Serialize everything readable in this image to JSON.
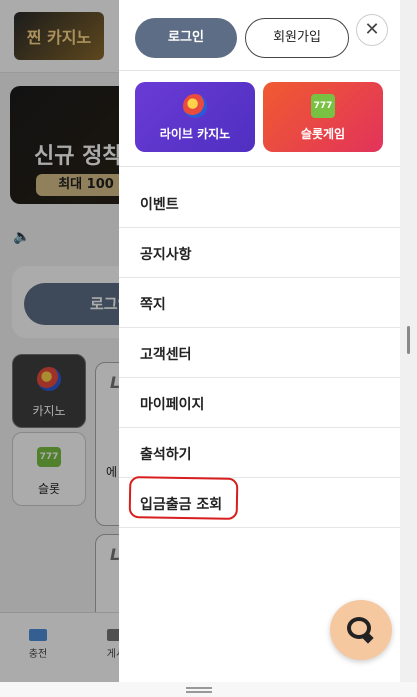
{
  "background": {
    "logo_text": "찐 카지노",
    "banner": {
      "headline": "신규 정착",
      "badge": "최대 100"
    },
    "login_label": "로그인",
    "tiles": [
      {
        "label": "카지노",
        "selected": true
      },
      {
        "label": "슬롯",
        "selected": false
      }
    ],
    "card_letter": "L",
    "card_partial_text": "에",
    "bottom_nav": [
      {
        "label": "충전"
      },
      {
        "label": "게시"
      }
    ]
  },
  "drawer": {
    "login_button": "로그인",
    "signup_button": "회원가입",
    "close_glyph": "✕",
    "game_cards": [
      {
        "label": "라이브 카지노",
        "icon": "casino-chip-icon",
        "color": "#5a37cf"
      },
      {
        "label": "슬롯게임",
        "icon": "slot-777-icon",
        "icon_text": "777",
        "color": "#e6414a"
      }
    ],
    "menu": [
      {
        "label": "이벤트"
      },
      {
        "label": "공지사항"
      },
      {
        "label": "쪽지"
      },
      {
        "label": "고객센터"
      },
      {
        "label": "마이페이지"
      },
      {
        "label": "출석하기"
      },
      {
        "label": "입금출금 조회",
        "annotated": true
      }
    ]
  },
  "chat_button": {
    "icon": "chat-bubble-icon",
    "color": "#f5c8a0"
  },
  "colors": {
    "primary_button": "#5d6d85",
    "annotation": "#d81e1e"
  }
}
